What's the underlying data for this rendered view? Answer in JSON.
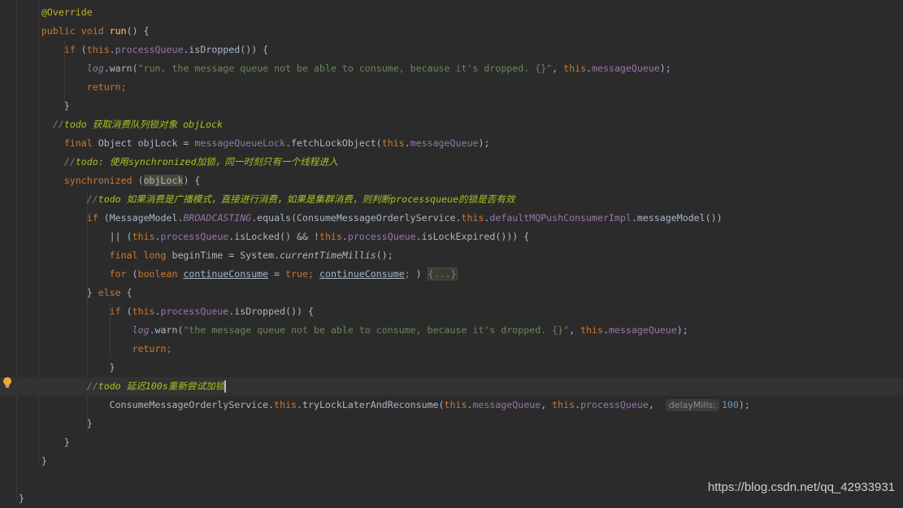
{
  "editor": {
    "current_line": 20,
    "colors": {
      "background": "#2b2b2b",
      "keyword": "#cc7832",
      "field": "#9876aa",
      "string": "#6a8759",
      "todo": "#a8c023",
      "annotation": "#bbb529",
      "number": "#6897bb",
      "text": "#a9b7c6"
    },
    "lines": [
      [
        [
          "ann",
          "    @Override"
        ]
      ],
      [
        [
          "kw",
          "    public void "
        ],
        [
          "fn",
          "run"
        ],
        [
          "",
          "() {"
        ]
      ],
      [
        [
          "kw",
          "        if "
        ],
        [
          "",
          "("
        ],
        [
          "kw",
          "this"
        ],
        [
          "",
          "."
        ],
        [
          "field",
          "processQueue"
        ],
        [
          "",
          ".isDropped()) {"
        ]
      ],
      [
        [
          "",
          "            "
        ],
        [
          "static",
          "log"
        ],
        [
          "",
          ".warn("
        ],
        [
          "str",
          "\"run, the message queue not be able to consume, because it's dropped. {}\""
        ],
        [
          "",
          ", "
        ],
        [
          "kw",
          "this"
        ],
        [
          "",
          "."
        ],
        [
          "field",
          "messageQueue"
        ],
        [
          "",
          ");"
        ]
      ],
      [
        [
          "kw",
          "            return;"
        ]
      ],
      [
        [
          "",
          "        }"
        ]
      ],
      [
        [
          "cm",
          "      //"
        ],
        [
          "todo",
          "todo 获取消费队列锁对象 objLock"
        ]
      ],
      [
        [
          "kw",
          "        final "
        ],
        [
          "",
          "Object objLock = "
        ],
        [
          "field",
          "messageQueueLock"
        ],
        [
          "",
          ".fetchLockObject("
        ],
        [
          "kw",
          "this"
        ],
        [
          "",
          "."
        ],
        [
          "field",
          "messageQueue"
        ],
        [
          "",
          ");"
        ]
      ],
      [
        [
          "cm",
          "        //"
        ],
        [
          "todo",
          "todo: 使用synchronized加锁，同一时刻只有一个线程进入"
        ]
      ],
      [
        [
          "kw",
          "        synchronized "
        ],
        [
          "",
          "("
        ],
        [
          "hl",
          "objLock"
        ],
        [
          "",
          ") {"
        ]
      ],
      [
        [
          "cm",
          "            //"
        ],
        [
          "todo",
          "todo 如果消费是广播模式，直接进行消费，如果是集群消费，则判断processqueue的锁是否有效"
        ]
      ],
      [
        [
          "kw",
          "            if "
        ],
        [
          "",
          "(MessageModel."
        ],
        [
          "static",
          "BROADCASTING"
        ],
        [
          "",
          ".equals(ConsumeMessageOrderlyService."
        ],
        [
          "kw",
          "this"
        ],
        [
          "",
          "."
        ],
        [
          "field",
          "defaultMQPushConsumerImpl"
        ],
        [
          "",
          ".messageModel())"
        ]
      ],
      [
        [
          "",
          "                || ("
        ],
        [
          "kw",
          "this"
        ],
        [
          "",
          "."
        ],
        [
          "field",
          "processQueue"
        ],
        [
          "",
          ".isLocked() && !"
        ],
        [
          "kw",
          "this"
        ],
        [
          "",
          "."
        ],
        [
          "field",
          "processQueue"
        ],
        [
          "",
          ".isLockExpired())) {"
        ]
      ],
      [
        [
          "kw",
          "                final long "
        ],
        [
          "",
          "beginTime = System."
        ],
        [
          "italic",
          "currentTimeMillis"
        ],
        [
          "",
          "();"
        ]
      ],
      [
        [
          "kw",
          "                for "
        ],
        [
          "",
          "("
        ],
        [
          "kw",
          "boolean "
        ],
        [
          "ul",
          "continueConsume"
        ],
        [
          "",
          " = "
        ],
        [
          "kw",
          "true; "
        ],
        [
          "ul",
          "continueConsume"
        ],
        [
          "kw",
          ";"
        ],
        [
          "",
          " ) "
        ],
        [
          "fold",
          "{...}"
        ]
      ],
      [
        [
          "",
          "            } "
        ],
        [
          "kw",
          "else "
        ],
        [
          "",
          "{"
        ]
      ],
      [
        [
          "kw",
          "                if "
        ],
        [
          "",
          "("
        ],
        [
          "kw",
          "this"
        ],
        [
          "",
          "."
        ],
        [
          "field",
          "processQueue"
        ],
        [
          "",
          ".isDropped()) {"
        ]
      ],
      [
        [
          "",
          "                    "
        ],
        [
          "static",
          "log"
        ],
        [
          "",
          ".warn("
        ],
        [
          "str",
          "\"the message queue not be able to consume, because it's dropped. {}\""
        ],
        [
          "",
          ", "
        ],
        [
          "kw",
          "this"
        ],
        [
          "",
          "."
        ],
        [
          "field",
          "messageQueue"
        ],
        [
          "",
          ");"
        ]
      ],
      [
        [
          "kw",
          "                    return;"
        ]
      ],
      [
        [
          "",
          "                }"
        ]
      ],
      [
        [
          "cm",
          "            //"
        ],
        [
          "todo",
          "todo 延迟100s重新尝试加锁"
        ],
        [
          "caret",
          ""
        ]
      ],
      [
        [
          "",
          "                ConsumeMessageOrderlyService."
        ],
        [
          "kw",
          "this"
        ],
        [
          "",
          ".tryLockLaterAndReconsume("
        ],
        [
          "kw",
          "this"
        ],
        [
          "",
          "."
        ],
        [
          "field",
          "messageQueue"
        ],
        [
          "",
          ", "
        ],
        [
          "kw",
          "this"
        ],
        [
          "",
          "."
        ],
        [
          "field",
          "processQueue"
        ],
        [
          "",
          ",  "
        ],
        [
          "hint",
          "delayMills:"
        ],
        [
          "num",
          "100"
        ],
        [
          "",
          ");"
        ]
      ],
      [
        [
          "",
          "            }"
        ]
      ],
      [
        [
          "",
          "        }"
        ]
      ],
      [
        [
          "",
          "    }"
        ]
      ],
      [
        [
          "",
          ""
        ]
      ],
      [
        [
          "",
          "}"
        ]
      ]
    ]
  },
  "gutter": {
    "intention_icon": "lightbulb-icon"
  },
  "watermark": "https://blog.csdn.net/qq_42933931"
}
